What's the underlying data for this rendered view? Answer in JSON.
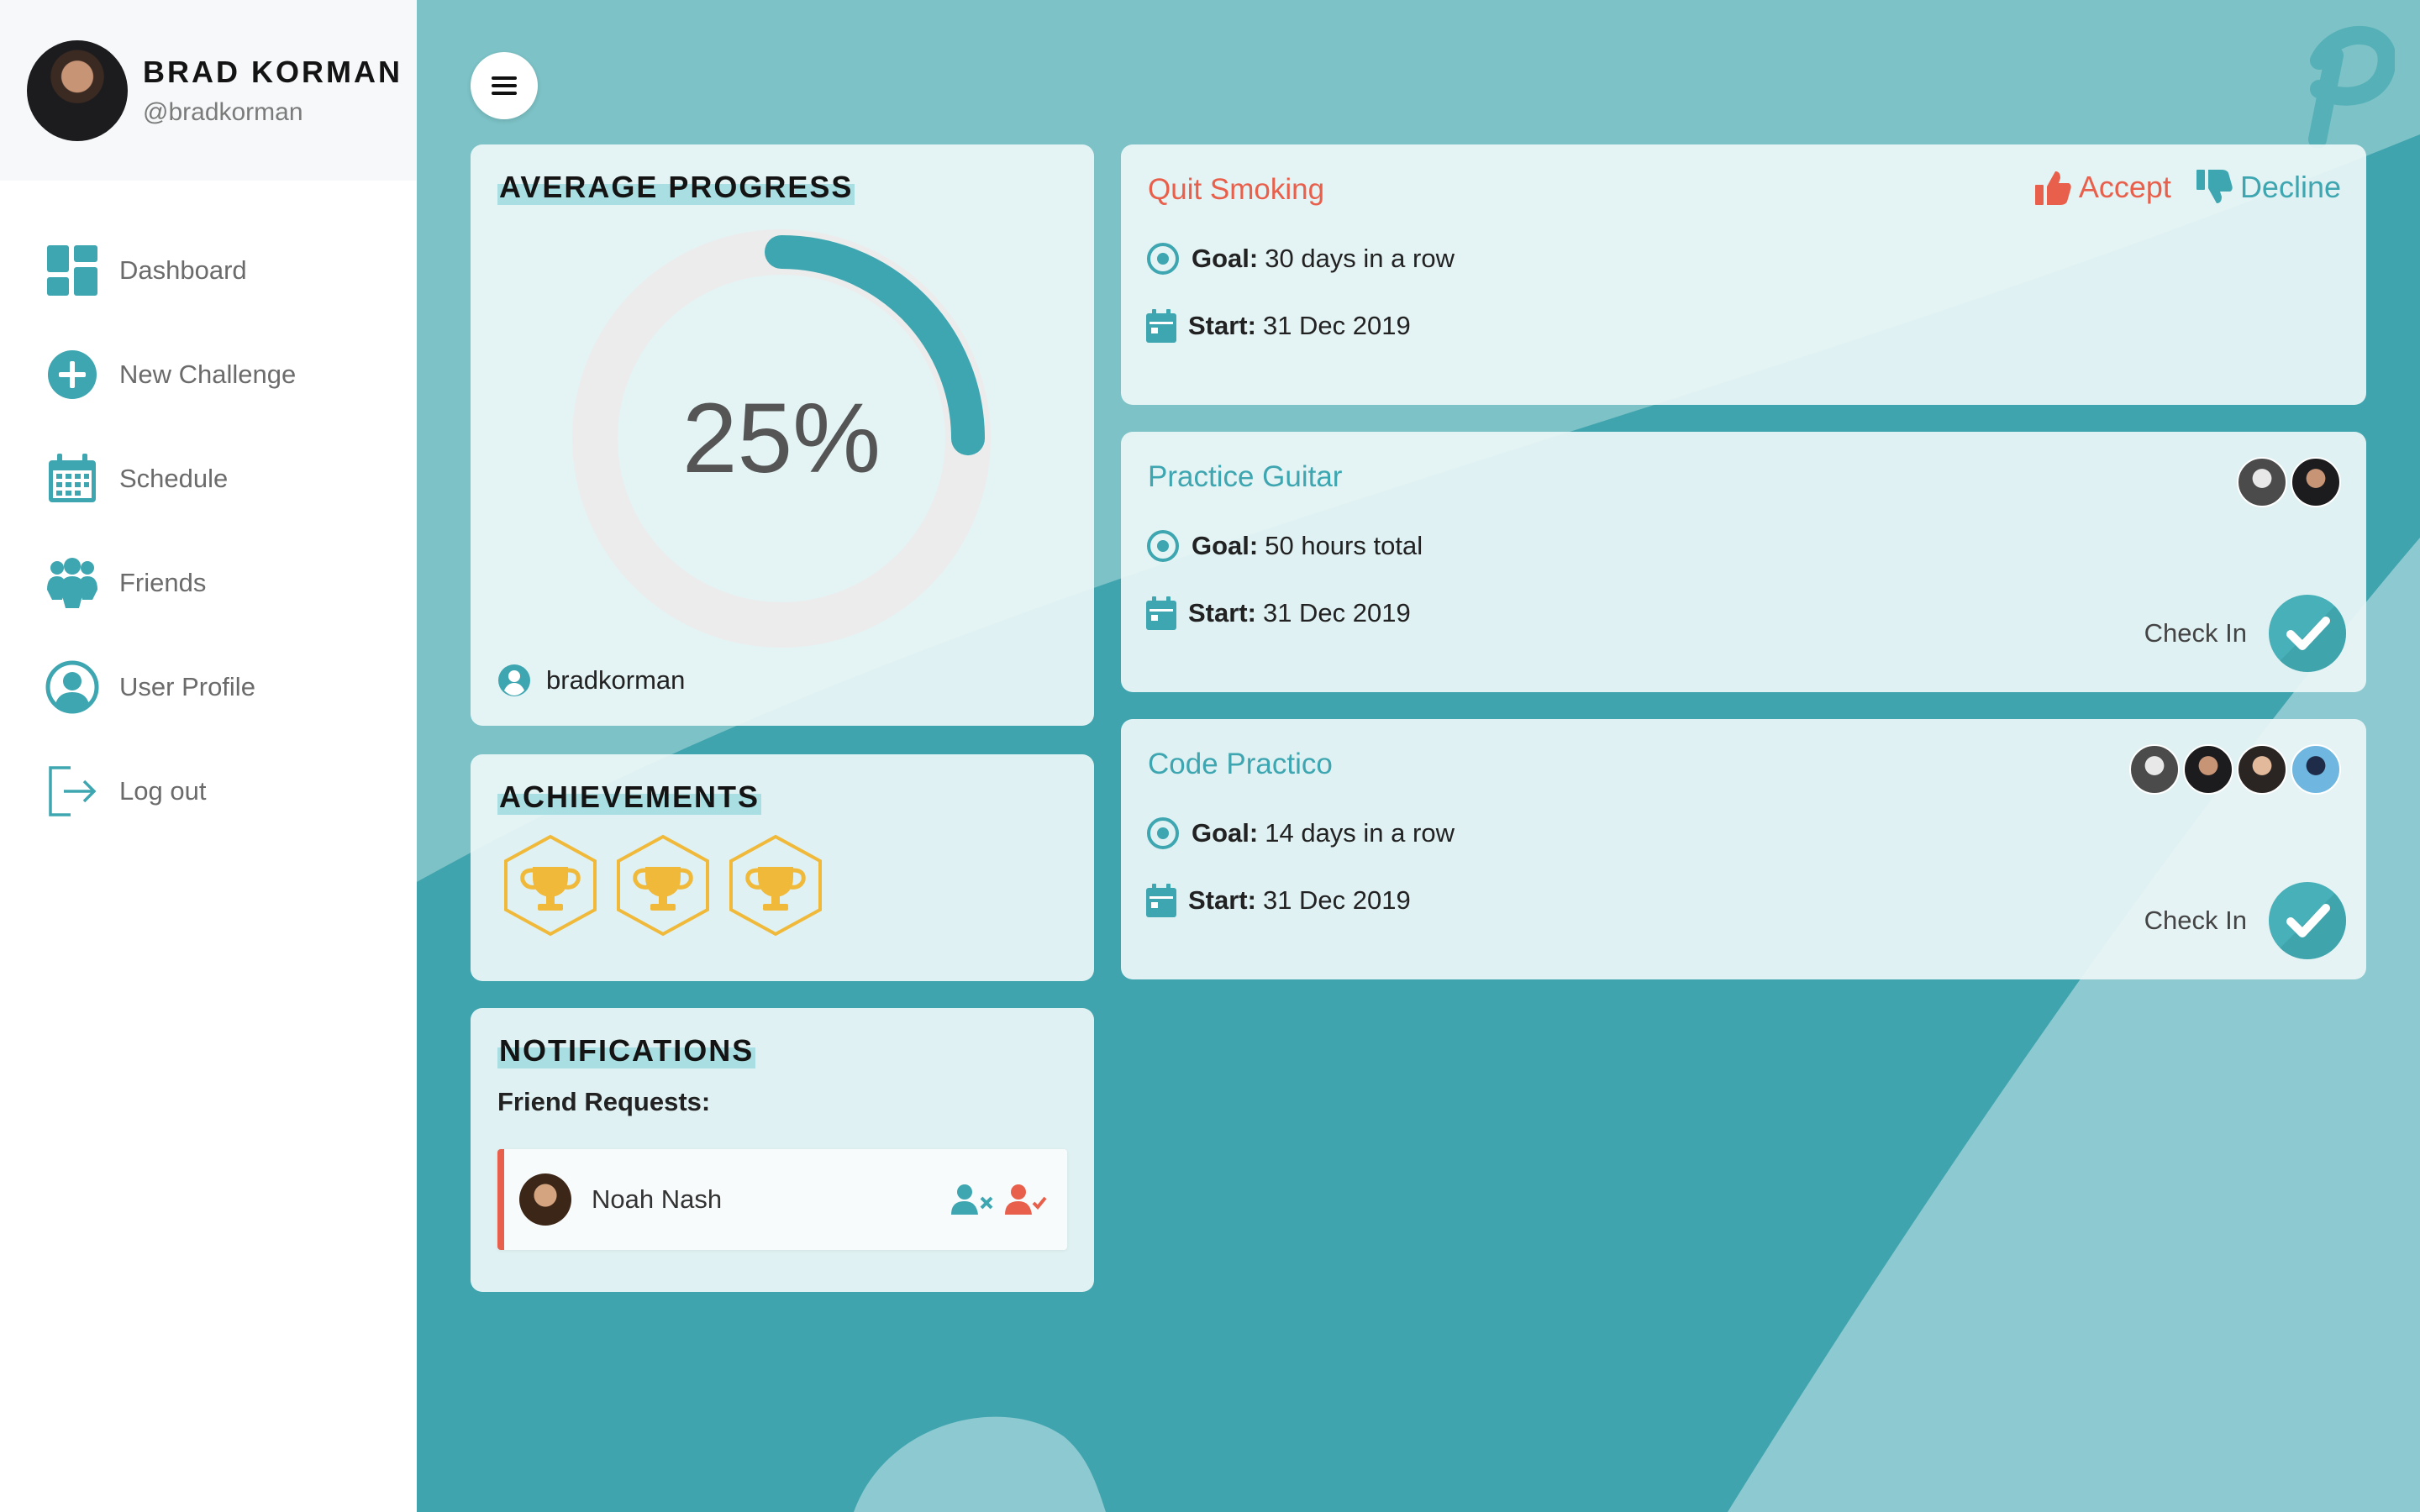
{
  "user": {
    "name": "BRAD KORMAN",
    "handle": "@bradkorman"
  },
  "nav": [
    {
      "label": "Dashboard",
      "icon": "dashboard-icon"
    },
    {
      "label": "New Challenge",
      "icon": "plus-circle-icon"
    },
    {
      "label": "Schedule",
      "icon": "calendar-icon"
    },
    {
      "label": "Friends",
      "icon": "friends-icon"
    },
    {
      "label": "User Profile",
      "icon": "user-circle-icon"
    },
    {
      "label": "Log out",
      "icon": "logout-icon"
    }
  ],
  "progress": {
    "title": "AVERAGE PROGRESS",
    "value_label": "25%",
    "value": 0.25,
    "username": "bradkorman"
  },
  "achievements": {
    "title": "ACHIEVEMENTS",
    "count": 3,
    "icon": "trophy-icon"
  },
  "notifications": {
    "title": "NOTIFICATIONS",
    "friend_requests_label": "Friend Requests:",
    "requests": [
      {
        "name": "Noah Nash"
      }
    ]
  },
  "challenges": [
    {
      "title": "Quit Smoking",
      "goal_label": "Goal:",
      "goal": "30 days in a row",
      "start_label": "Start:",
      "start": "31 Dec 2019",
      "accept_label": "Accept",
      "decline_label": "Decline"
    },
    {
      "title": "Practice Guitar",
      "goal_label": "Goal:",
      "goal": "50 hours total",
      "start_label": "Start:",
      "start": "31 Dec 2019",
      "checkin_label": "Check In",
      "participants": 2
    },
    {
      "title": "Code Practico",
      "goal_label": "Goal:",
      "goal": "14 days in a row",
      "start_label": "Start:",
      "start": "31 Dec 2019",
      "checkin_label": "Check In",
      "participants": 4
    }
  ],
  "colors": {
    "teal": "#3ea6b0",
    "coral": "#e8604c",
    "gold": "#f0b93a",
    "background": "#7cc2c6"
  }
}
